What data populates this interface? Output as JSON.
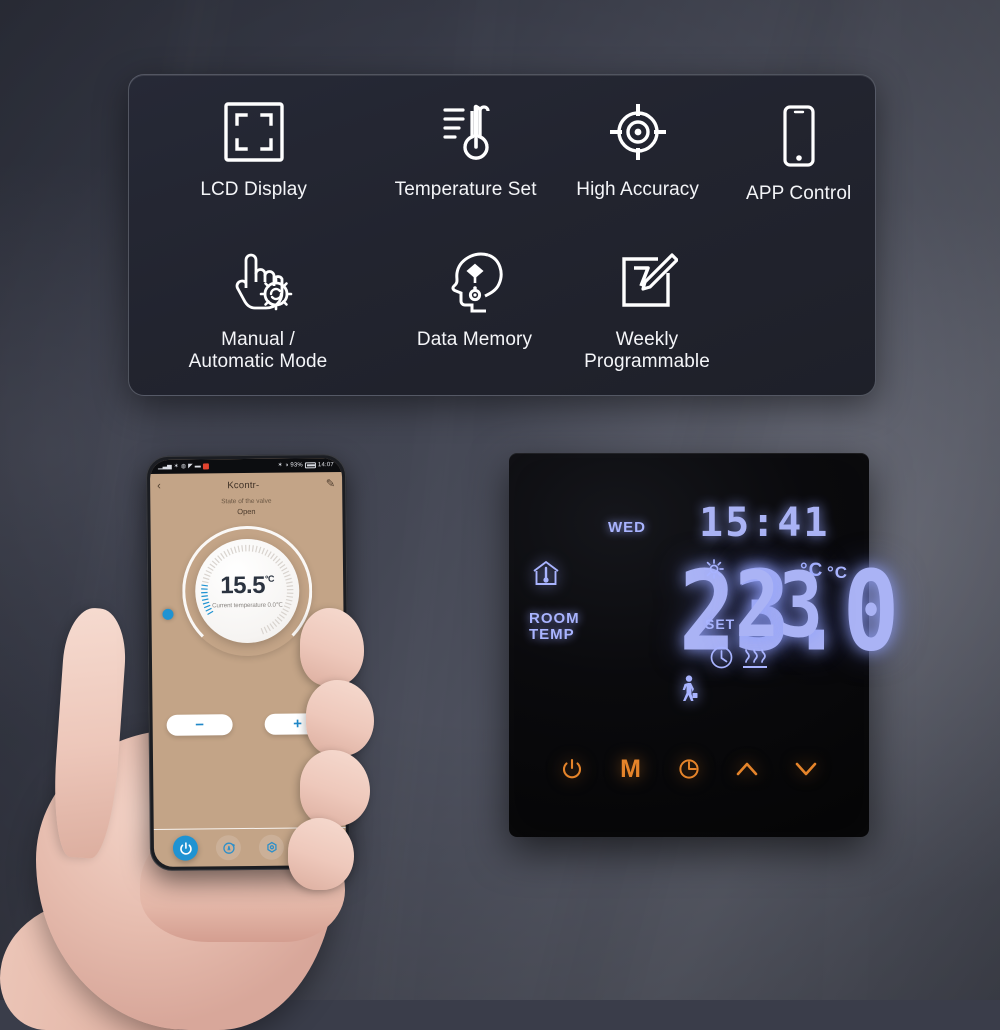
{
  "background": {
    "color_dark": "#2f323e",
    "color_light": "#5b5e6a"
  },
  "feature_panel": {
    "panel_bg": "#22242f",
    "text_color": "#f4f5f8",
    "rows": [
      [
        {
          "icon": "lcd-display-icon",
          "label": "LCD Display"
        },
        {
          "icon": "thermometer-icon",
          "label": "Temperature Set"
        },
        {
          "icon": "crosshair-target-icon",
          "label": "High Accuracy"
        },
        {
          "icon": "smartphone-icon",
          "label": "APP Control"
        }
      ],
      [
        {
          "icon": "hand-gear-icon",
          "label": "Manual /\nAutomatic Mode"
        },
        {
          "icon": "head-memory-icon",
          "label": "Data Memory"
        },
        {
          "icon": "calendar-pencil-icon",
          "label": "Weekly\nProgrammable"
        }
      ]
    ]
  },
  "thermostat": {
    "accent_lcd": "#a9b4ff",
    "accent_touch": "#e5842a",
    "lcd": {
      "day": "WED",
      "clock": "15:41",
      "room_temp": "23.0",
      "room_temp_unit": "°C",
      "room_temp_label": "ROOM\nTEMP",
      "set_temp": "23",
      "set_temp_unit": "°C",
      "set_label": "SET",
      "icons": [
        "house-thermometer-icon",
        "sun-icon",
        "walking-person-icon",
        "clock-icon",
        "heat-waves-icon"
      ]
    },
    "touch_buttons": [
      {
        "name": "power-button",
        "glyph": "⏻"
      },
      {
        "name": "mode-button",
        "glyph": "M"
      },
      {
        "name": "timer-button",
        "glyph": "◴"
      },
      {
        "name": "up-button",
        "glyph": "∧"
      },
      {
        "name": "down-button",
        "glyph": "∨"
      }
    ]
  },
  "phone": {
    "screen_bg": "#c3a487",
    "accent": "#1f93d2",
    "statusbar": {
      "battery_percent": "93%",
      "time": "14:07"
    },
    "appbar": {
      "back_icon": "chevron-left-icon",
      "title": "Kcontr-",
      "edit_icon": "pencil-icon"
    },
    "valve": {
      "label": "State of the valve",
      "state": "Open"
    },
    "dial": {
      "target_temp": "15.5",
      "target_unit": "°C",
      "current_text": "Current temperature 0.0℃"
    },
    "steppers": [
      {
        "name": "decrease-temp-button",
        "glyph": "−"
      },
      {
        "name": "increase-temp-button",
        "glyph": "+"
      }
    ],
    "bottombar": [
      {
        "name": "power-toggle",
        "glyph": "⏻",
        "active": true
      },
      {
        "name": "auto-cycle-button",
        "glyph": "Ⓐ",
        "active": false
      },
      {
        "name": "settings-button",
        "glyph": "⬡",
        "active": false
      },
      {
        "name": "auto-mode-button",
        "glyph": "Ⓐ",
        "active": false
      }
    ]
  }
}
